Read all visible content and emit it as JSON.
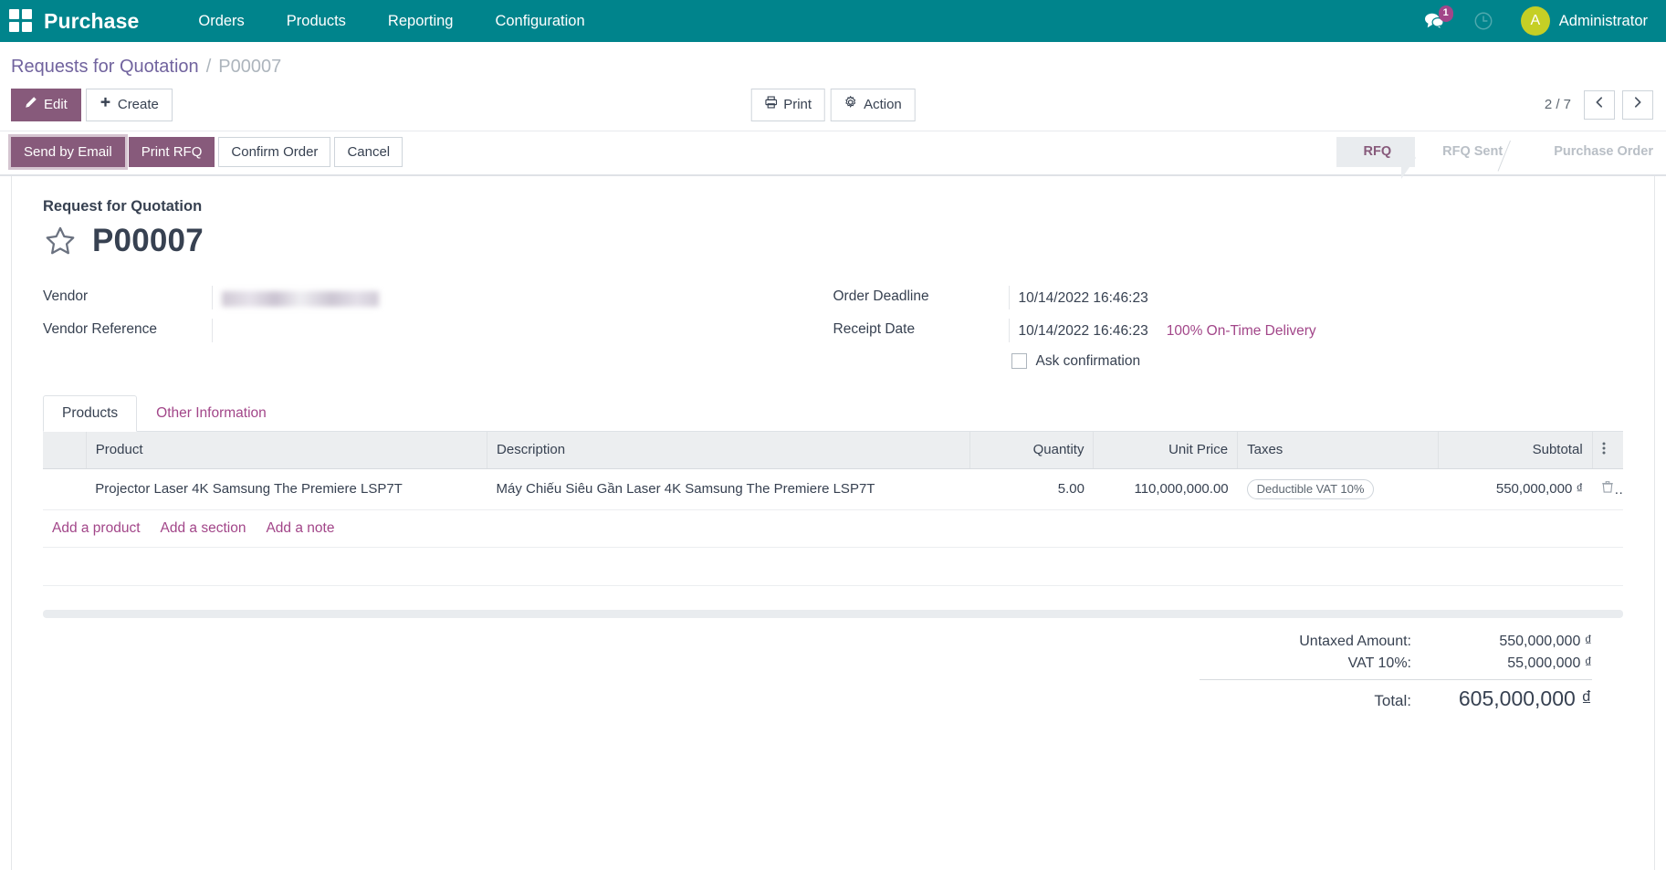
{
  "navbar": {
    "apps_icon": "apps-grid-icon",
    "brand": "Purchase",
    "menu": [
      {
        "label": "Orders"
      },
      {
        "label": "Products"
      },
      {
        "label": "Reporting"
      },
      {
        "label": "Configuration"
      }
    ],
    "messages_icon": "messages-icon",
    "messages_badge": "1",
    "activity_icon": "clock-icon",
    "avatar_initial": "A",
    "user_name": "Administrator",
    "accent_color": "#00848c",
    "badge_color": "#a24689",
    "avatar_color": "#c5cf25"
  },
  "breadcrumb": {
    "root": "Requests for Quotation",
    "separator": "/",
    "current": "P00007"
  },
  "control_panel": {
    "edit_label": "Edit",
    "create_label": "Create",
    "print_label": "Print",
    "action_label": "Action",
    "pager_text": "2 / 7",
    "prev_icon": "chevron-left-icon",
    "next_icon": "chevron-right-icon"
  },
  "statusbar": {
    "buttons": [
      {
        "label": "Send by Email",
        "style": "primary-focused"
      },
      {
        "label": "Print RFQ",
        "style": "primary"
      },
      {
        "label": "Confirm Order",
        "style": "secondary"
      },
      {
        "label": "Cancel",
        "style": "secondary"
      }
    ],
    "stages": [
      {
        "label": "RFQ",
        "active": true
      },
      {
        "label": "RFQ Sent",
        "active": false
      },
      {
        "label": "Purchase Order",
        "active": false
      }
    ]
  },
  "form": {
    "title_label": "Request for Quotation",
    "star_icon": "star-outline-icon",
    "doc_name": "P00007",
    "left_fields": [
      {
        "label": "Vendor",
        "value": "",
        "redacted": true
      },
      {
        "label": "Vendor Reference",
        "value": "",
        "redacted": false
      }
    ],
    "right_fields": [
      {
        "label": "Order Deadline",
        "value": "10/14/2022 16:46:23",
        "link": ""
      },
      {
        "label": "Receipt Date",
        "value": "10/14/2022 16:46:23",
        "link": "100% On-Time Delivery"
      }
    ],
    "checkbox_label": "Ask confirmation",
    "checkbox_checked": false
  },
  "notebook": {
    "tabs": [
      {
        "label": "Products",
        "active": true
      },
      {
        "label": "Other Information",
        "active": false
      }
    ]
  },
  "lines": {
    "headers": {
      "product": "Product",
      "description": "Description",
      "quantity": "Quantity",
      "unit_price": "Unit Price",
      "taxes": "Taxes",
      "subtotal": "Subtotal",
      "options_icon": "optional-columns-icon"
    },
    "rows": [
      {
        "product": "Projector Laser 4K Samsung The Premiere LSP7T",
        "description": "Máy Chiếu Siêu Gần Laser 4K Samsung The Premiere LSP7T",
        "quantity": "5.00",
        "unit_price": "110,000,000.00",
        "taxes": "Deductible VAT 10%",
        "subtotal": "550,000,000 ₫",
        "delete_icon": "trash-icon"
      }
    ],
    "add_links": [
      {
        "label": "Add a product"
      },
      {
        "label": "Add a section"
      },
      {
        "label": "Add a note"
      }
    ]
  },
  "totals": {
    "untaxed_label": "Untaxed Amount:",
    "untaxed_value": "550,000,000 ₫",
    "tax_label": "VAT 10%:",
    "tax_value": "55,000,000 ₫",
    "total_label": "Total:",
    "total_value": "605,000,000 ₫"
  }
}
